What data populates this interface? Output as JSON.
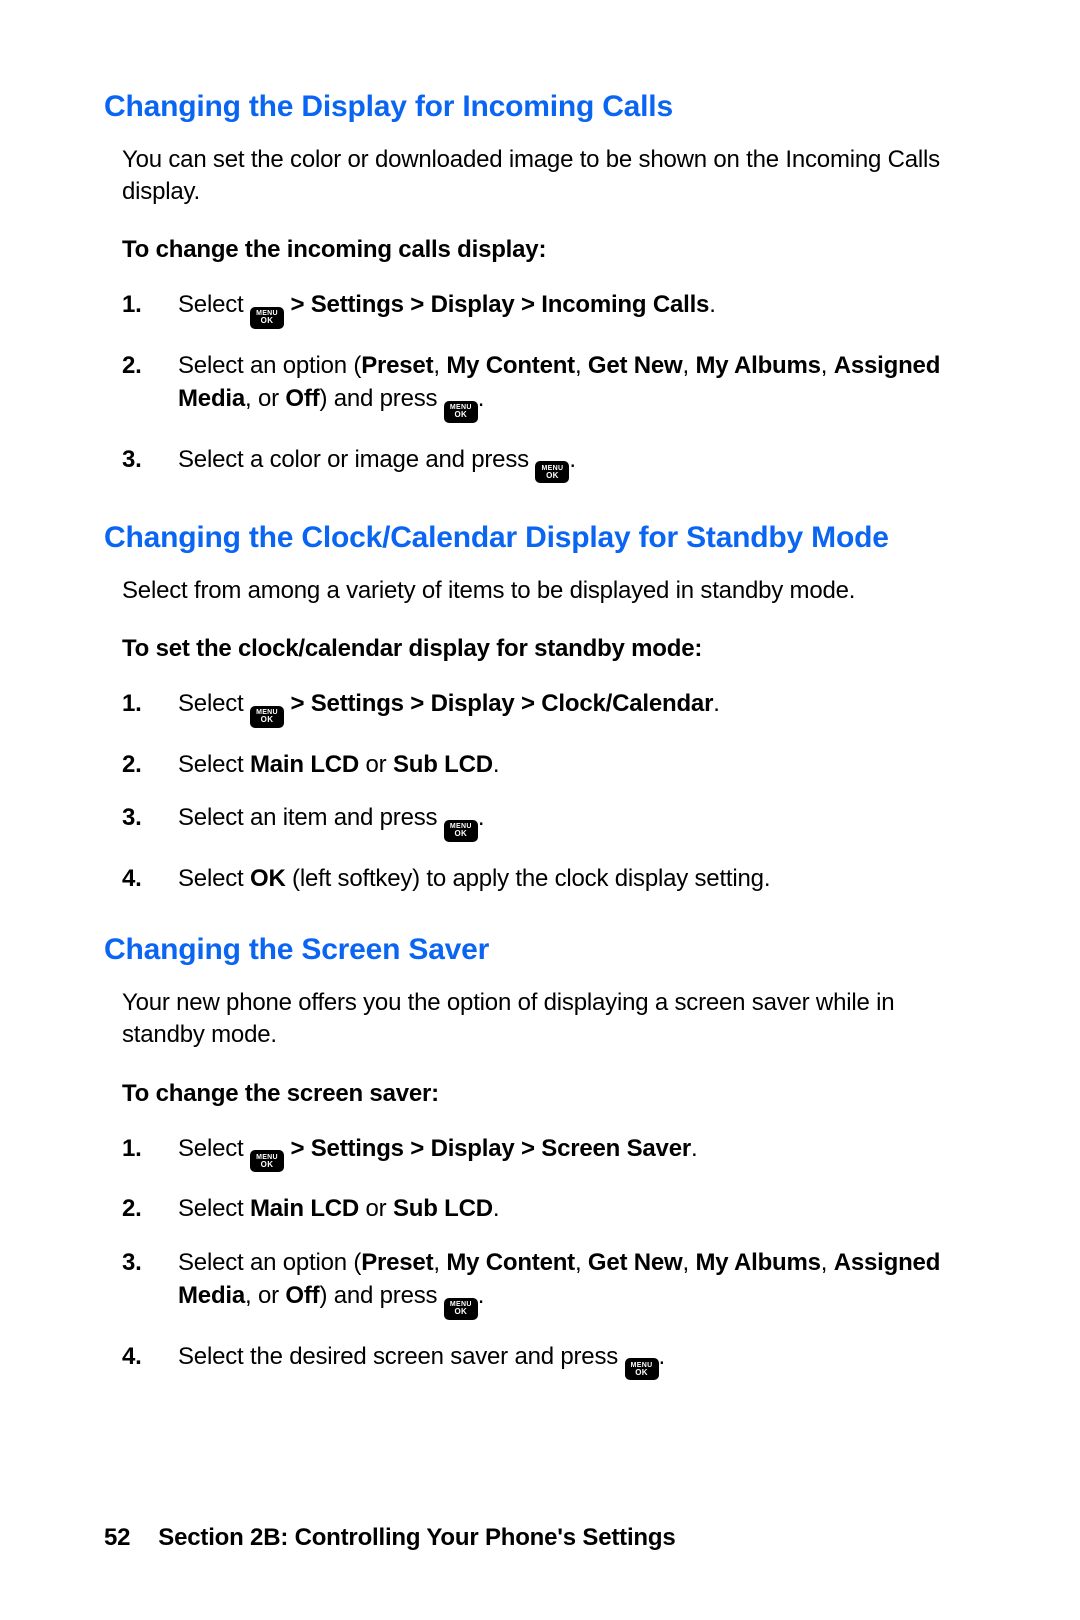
{
  "icon": {
    "line1": "MENU",
    "line2": "OK"
  },
  "s1": {
    "heading": "Changing the Display for Incoming Calls",
    "intro": "You can set the color or downloaded image to be shown on the Incoming Calls display.",
    "subhead": "To change the incoming calls display:",
    "steps": {
      "n1": "1.",
      "n2": "2.",
      "n3": "3.",
      "step1_a": "Select ",
      "step1_b": " > Settings > Display > Incoming Calls",
      "step1_c": ".",
      "step2_a": "Select an option (",
      "step2_b1": "Preset",
      "c1": ", ",
      "step2_b2": "My Content",
      "c2": ", ",
      "step2_b3": "Get New",
      "c3": ", ",
      "step2_b4": "My Albums",
      "c4": ", ",
      "step2_b5": "Assigned Media",
      "c5": ", or ",
      "step2_b6": "Off",
      "step2_c": ") and press ",
      "step2_d": ".",
      "step3_a": "Select a color or image and press ",
      "step3_b": "."
    }
  },
  "s2": {
    "heading": "Changing the Clock/Calendar Display for Standby Mode",
    "intro": "Select from among a variety of items to be displayed in standby mode.",
    "subhead": "To set the clock/calendar display for standby mode:",
    "steps": {
      "n1": "1.",
      "n2": "2.",
      "n3": "3.",
      "n4": "4.",
      "step1_a": "Select ",
      "step1_b": " > Settings > Display > Clock/Calendar",
      "step1_c": ".",
      "step2_a": "Select ",
      "step2_b1": "Main LCD",
      "step2_mid": " or ",
      "step2_b2": "Sub LCD",
      "step2_c": ".",
      "step3_a": "Select an item and press ",
      "step3_b": ".",
      "step4_a": "Select ",
      "step4_b": "OK",
      "step4_c": " (left softkey) to apply the clock display setting."
    }
  },
  "s3": {
    "heading": "Changing the Screen Saver",
    "intro": "Your new phone offers you the option of displaying a screen saver while in standby mode.",
    "subhead": "To change the screen saver:",
    "steps": {
      "n1": "1.",
      "n2": "2.",
      "n3": "3.",
      "n4": "4.",
      "step1_a": "Select ",
      "step1_b": " > Settings > Display > Screen Saver",
      "step1_c": ".",
      "step2_a": "Select ",
      "step2_b1": "Main LCD",
      "step2_mid": " or ",
      "step2_b2": "Sub LCD",
      "step2_c": ".",
      "step3_a": "Select an option (",
      "step3_b1": "Preset",
      "c1": ", ",
      "step3_b2": "My Content",
      "c2": ", ",
      "step3_b3": "Get New",
      "c3": ", ",
      "step3_b4": "My Albums",
      "c4": ", ",
      "step3_b5": "Assigned Media",
      "c5": ", or ",
      "step3_b6": "Off",
      "step3_c": ") and press ",
      "step3_d": ".",
      "step4_a": "Select the desired screen saver and press ",
      "step4_b": "."
    }
  },
  "footer": {
    "page": "52",
    "text": "Section 2B: Controlling Your Phone's Settings"
  }
}
